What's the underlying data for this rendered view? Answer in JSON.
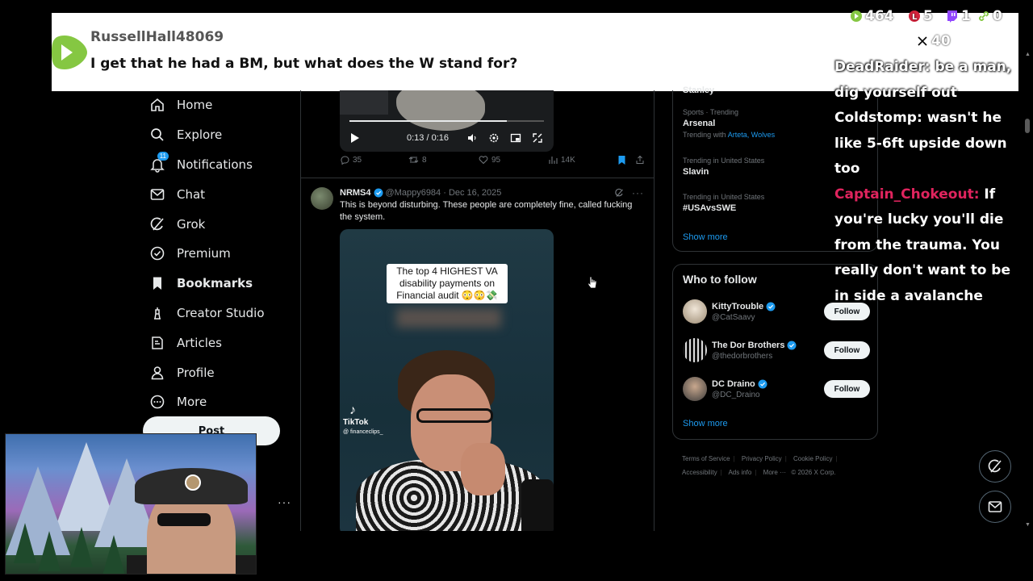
{
  "sidebar": {
    "items": [
      {
        "label": "Home",
        "icon": "home-icon"
      },
      {
        "label": "Explore",
        "icon": "search-icon"
      },
      {
        "label": "Notifications",
        "icon": "bell-icon",
        "badge": "11"
      },
      {
        "label": "Chat",
        "icon": "mail-icon"
      },
      {
        "label": "Grok",
        "icon": "grok-icon"
      },
      {
        "label": "Premium",
        "icon": "premium-icon"
      },
      {
        "label": "Bookmarks",
        "icon": "bookmark-icon",
        "active": true
      },
      {
        "label": "Creator Studio",
        "icon": "creator-studio-icon"
      },
      {
        "label": "Articles",
        "icon": "articles-icon"
      },
      {
        "label": "Profile",
        "icon": "profile-icon"
      },
      {
        "label": "More",
        "icon": "more-circle-icon"
      }
    ],
    "post_label": "Post",
    "more_dots": "···"
  },
  "feed": {
    "video1": {
      "time": "0:13 / 0:16",
      "progress": 0.81
    },
    "actions": {
      "replies": "35",
      "reposts": "8",
      "likes": "95",
      "views": "14K"
    },
    "tweet2": {
      "name": "NRMS4",
      "handle": "@Mappy6984 · Dec 16, 2025",
      "text": "This is beyond disturbing. These people are completely fine, called fucking the system.",
      "video_caption": "The top 4 HIGHEST VA disability payments on Financial audit 😳😳💸",
      "tiktok_label": "TikTok",
      "tiktok_handle": "@ financeclips_"
    }
  },
  "trends": {
    "partial": "Stanley",
    "items": [
      {
        "category": "Sports · Trending",
        "name": "Arsenal",
        "with_prefix": "Trending with",
        "with_links": "Arteta, Wolves"
      },
      {
        "category": "Trending in United States",
        "name": "Slavin"
      },
      {
        "category": "Trending in United States",
        "name": "#USAvsSWE"
      }
    ],
    "show_more": "Show more"
  },
  "who_to_follow": {
    "title": "Who to follow",
    "items": [
      {
        "name": "KittyTrouble",
        "handle": "@CatSaavy",
        "button": "Follow"
      },
      {
        "name": "The Dor Brothers",
        "handle": "@thedorbrothers",
        "button": "Follow"
      },
      {
        "name": "DC Draino",
        "handle": "@DC_Draino",
        "button": "Follow"
      }
    ],
    "show_more": "Show more"
  },
  "footer": {
    "links": [
      "Terms of Service",
      "Privacy Policy",
      "Cookie Policy",
      "Accessibility",
      "Ads info",
      "More ···",
      "© 2026 X Corp."
    ]
  },
  "banner": {
    "username": "RussellHall48069",
    "message": "I get that he had a BM, but what does the W stand for?"
  },
  "stats": {
    "rumble": "464",
    "locals": "5",
    "twitch": "1",
    "links": "0",
    "x": "40"
  },
  "chat": [
    {
      "user": "DeadRaider:",
      "text": "be a man, dig yourself out"
    },
    {
      "user": "Coldstomp:",
      "text": "wasn't he like 5-6ft upside down too"
    },
    {
      "user": "Captain_Chokeout:",
      "text": "If you're lucky you'll die from the trauma. You really don't want to be in side a avalanche",
      "user_color": "#e0245e"
    }
  ],
  "colors": {
    "accent": "#1d9bf0",
    "rumble_green": "#85c742",
    "chat_highlight": "#e0245e"
  }
}
